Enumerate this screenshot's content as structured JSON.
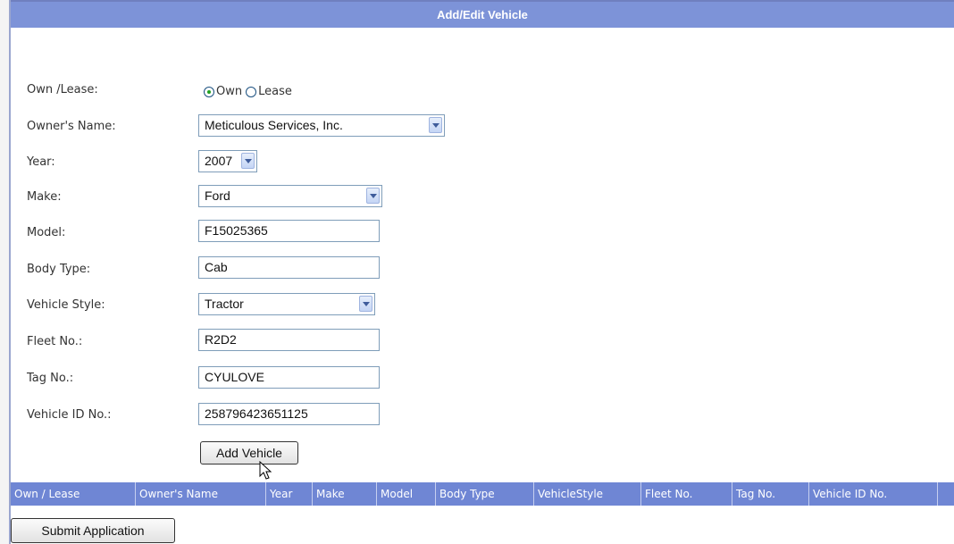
{
  "header": {
    "title": "Add/Edit Vehicle"
  },
  "form": {
    "own_lease": {
      "label": "Own /Lease:",
      "options": [
        "Own",
        "Lease"
      ],
      "selected": "Own"
    },
    "owner_name": {
      "label": "Owner's Name:",
      "value": "Meticulous Services, Inc."
    },
    "year": {
      "label": "Year:",
      "value": "2007"
    },
    "make": {
      "label": "Make:",
      "value": "Ford"
    },
    "model": {
      "label": "Model:",
      "value": "F15025365"
    },
    "body_type": {
      "label": "Body Type:",
      "value": "Cab"
    },
    "vehicle_style": {
      "label": "Vehicle Style:",
      "value": "Tractor"
    },
    "fleet_no": {
      "label": "Fleet No.:",
      "value": "R2D2"
    },
    "tag_no": {
      "label": "Tag No.:",
      "value": "CYULOVE"
    },
    "vehicle_id": {
      "label": "Vehicle ID No.:",
      "value": "258796423651125"
    }
  },
  "buttons": {
    "add_vehicle": "Add Vehicle",
    "submit_application": "Submit Application"
  },
  "grid": {
    "columns": [
      "Own / Lease",
      "Owner's Name",
      "Year",
      "Make",
      "Model",
      "Body Type",
      "VehicleStyle",
      "Fleet No.",
      "Tag No.",
      "Vehicle ID No."
    ]
  },
  "colors": {
    "header_bg": "#7d93d8",
    "grid_header_bg": "#6f86d4",
    "radio_selected": "#21a121"
  },
  "icons": {
    "select_arrow": "chevron-down-icon",
    "cursor": "mouse-pointer-icon"
  }
}
